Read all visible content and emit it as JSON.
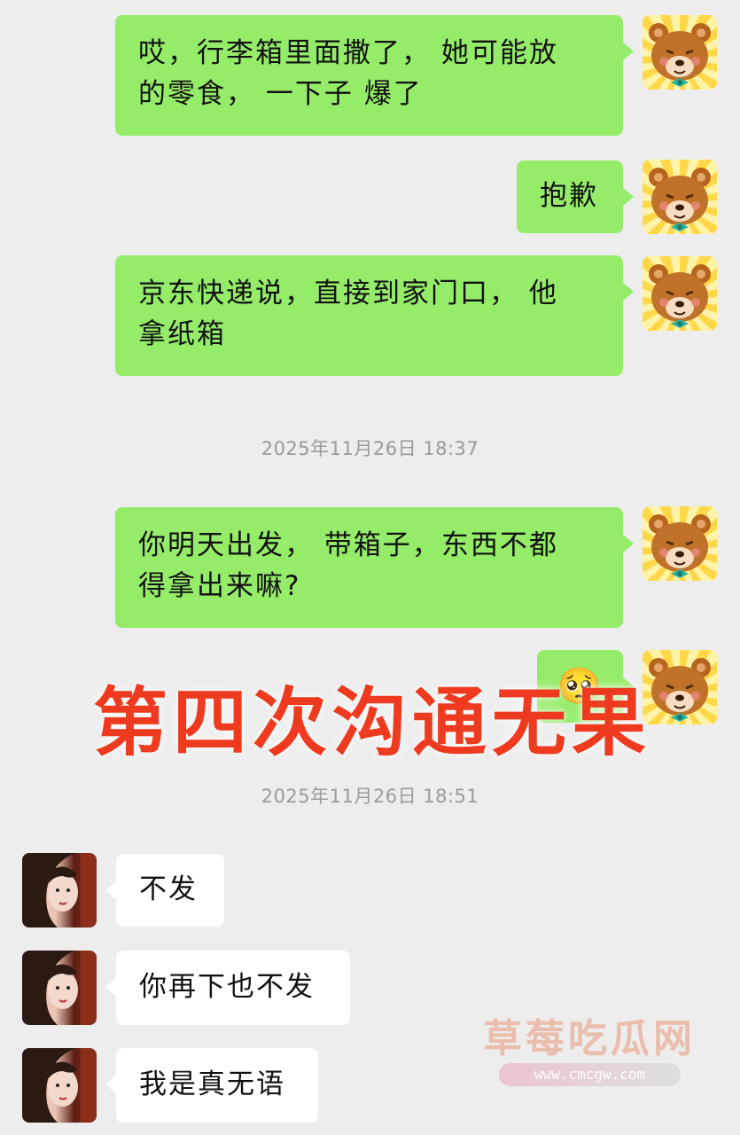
{
  "messages": [
    {
      "sender": "me",
      "text_line1": "哎，行李箱里面撒了， 她可能放",
      "text_line2": "的零食， 一下子  爆了"
    },
    {
      "sender": "me",
      "text": "抱歉"
    },
    {
      "sender": "me",
      "text_line1": "京东快递说，直接到家门口， 他",
      "text_line2": "拿纸箱"
    },
    {
      "sender": "me",
      "text_line1": "你明天出发， 带箱子，东西不都",
      "text_line2": "得拿出来嘛?"
    },
    {
      "sender": "me",
      "emoji": "🥺"
    },
    {
      "sender": "other",
      "text": "不发"
    },
    {
      "sender": "other",
      "text": "你再下也不发"
    },
    {
      "sender": "other",
      "text": "我是真无语"
    }
  ],
  "timestamps": [
    "2025年11月26日 18:37",
    "2025年11月26日 18:51"
  ],
  "overlay": {
    "caption": "第四次沟通无果",
    "color": "#ee3b1f"
  },
  "watermark": {
    "title": "草莓吃瓜网",
    "url": "www.cmcgw.com"
  },
  "colors": {
    "outgoing_bubble": "#95ec69",
    "incoming_bubble": "#ffffff",
    "background": "#ededed"
  },
  "avatars": {
    "me": "bear-sticker-avatar",
    "other": "woman-photo-avatar"
  }
}
